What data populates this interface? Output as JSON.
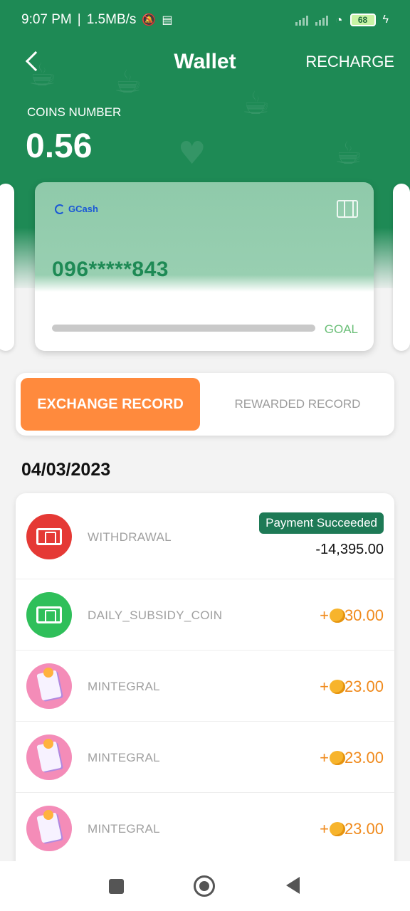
{
  "status_bar": {
    "time": "9:07 PM",
    "speed": "1.5MB/s",
    "battery": "68",
    "icons": [
      "mute-icon",
      "message-icon",
      "signal-icon",
      "wifi-icon",
      "battery-icon",
      "charging-icon"
    ]
  },
  "header": {
    "title": "Wallet",
    "recharge_label": "RECHARGE",
    "back_icon": "back-arrow-icon"
  },
  "coins": {
    "label": "COINS NUMBER",
    "value": "0.56"
  },
  "card": {
    "brand": "GCash",
    "number": "096*****843",
    "goal_label": "GOAL",
    "progress": 0
  },
  "tabs": {
    "exchange": "EXCHANGE RECORD",
    "rewarded": "REWARDED RECORD"
  },
  "date": "04/03/2023",
  "records": [
    {
      "label": "WITHDRAWAL",
      "status": "Payment Succeeded",
      "amount": "-14,395.00",
      "icon": "withdrawal-icon"
    },
    {
      "label": "DAILY_SUBSIDY_COIN",
      "plus": "+",
      "amount": "30.00",
      "icon": "money-icon"
    },
    {
      "label": "MINTEGRAL",
      "plus": "+",
      "amount": "23.00",
      "icon": "reward-icon"
    },
    {
      "label": "MINTEGRAL",
      "plus": "+",
      "amount": "23.00",
      "icon": "reward-icon"
    },
    {
      "label": "MINTEGRAL",
      "plus": "+",
      "amount": "23.00",
      "icon": "reward-icon"
    }
  ],
  "colors": {
    "brand_green": "#1e8a55",
    "accent_orange": "#ff8a3d",
    "withdrawal_red": "#e53935",
    "subsidy_green": "#2fbf5a",
    "reward_pink": "#f48cb8",
    "amount_orange": "#f08a1c"
  }
}
